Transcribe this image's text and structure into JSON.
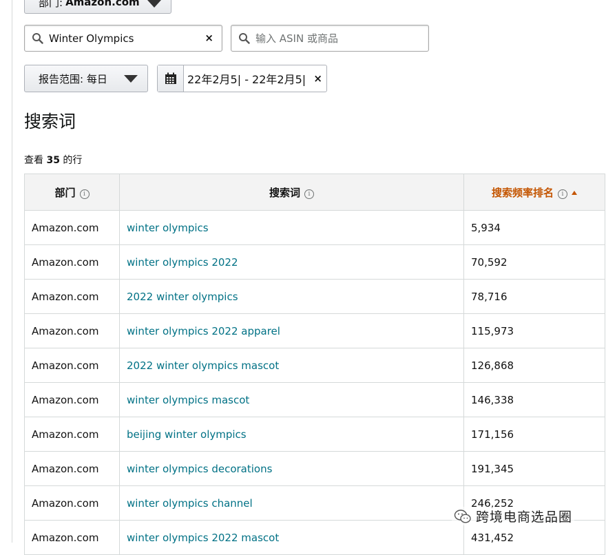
{
  "filters": {
    "department_prefix": "部门:",
    "department_value": "Amazon.com",
    "search_term_value": "Winter Olympics",
    "asin_placeholder": "输入 ASIN 或商品",
    "clear_glyph": "×",
    "report_range_label": "报告范围: 每日",
    "date_range": "22年2月5| - 22年2月5|"
  },
  "section": {
    "title": "搜索词",
    "row_count_prefix": "查看",
    "row_count": "35",
    "row_count_suffix": "的行"
  },
  "table": {
    "headers": {
      "department": "部门",
      "search_term": "搜索词",
      "rank": "搜索频率排名"
    },
    "rows": [
      {
        "department": "Amazon.com",
        "term": "winter olympics",
        "rank": "5,934"
      },
      {
        "department": "Amazon.com",
        "term": "winter olympics 2022",
        "rank": "70,592"
      },
      {
        "department": "Amazon.com",
        "term": "2022 winter olympics",
        "rank": "78,716"
      },
      {
        "department": "Amazon.com",
        "term": "winter olympics 2022 apparel",
        "rank": "115,973"
      },
      {
        "department": "Amazon.com",
        "term": "2022 winter olympics mascot",
        "rank": "126,868"
      },
      {
        "department": "Amazon.com",
        "term": "winter olympics mascot",
        "rank": "146,338"
      },
      {
        "department": "Amazon.com",
        "term": "beijing winter olympics",
        "rank": "171,156"
      },
      {
        "department": "Amazon.com",
        "term": "winter olympics decorations",
        "rank": "191,345"
      },
      {
        "department": "Amazon.com",
        "term": "winter olympics channel",
        "rank": "246,252"
      },
      {
        "department": "Amazon.com",
        "term": "winter olympics 2022 mascot",
        "rank": "431,452"
      }
    ]
  },
  "watermark": {
    "text": "跨境电商选品圈",
    "icon": "wechat-icon"
  },
  "colors": {
    "link": "#007185",
    "sorted_header": "#c45500",
    "header_bg": "#f3f3f3",
    "border": "#d5d9d9"
  }
}
